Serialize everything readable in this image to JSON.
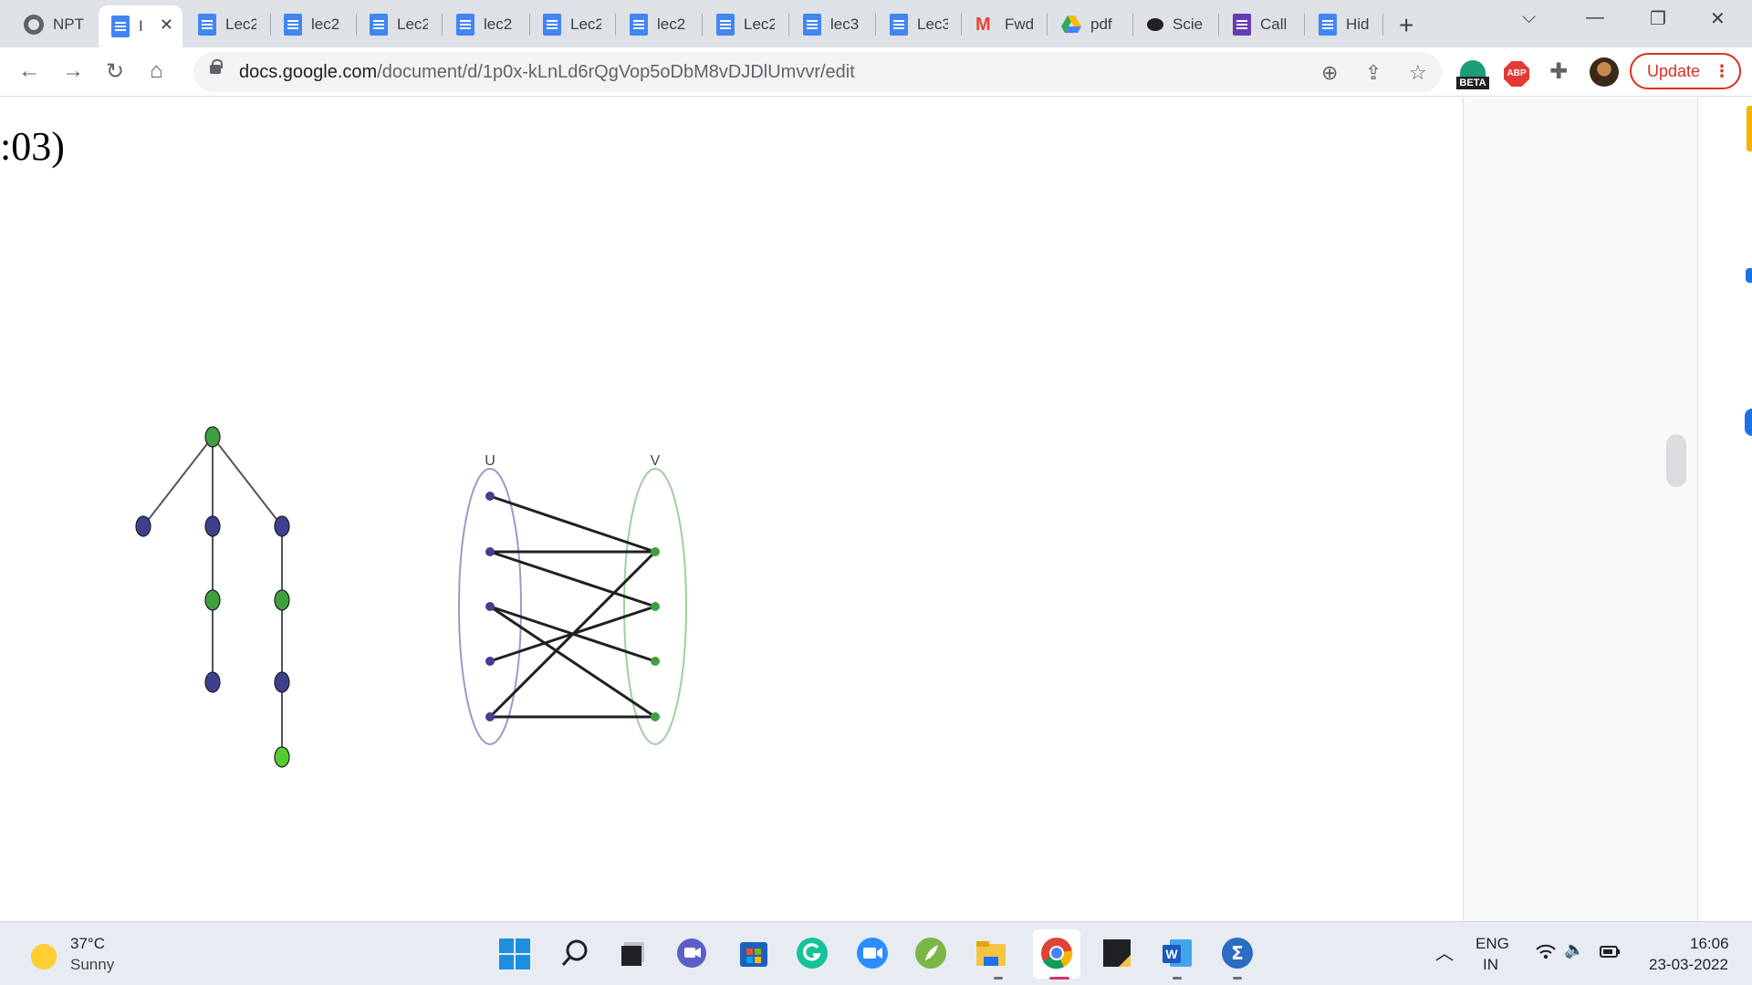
{
  "tabs": [
    {
      "label": "NPT",
      "icon": "globe-icon",
      "active": false
    },
    {
      "label": "I",
      "icon": "docs-icon",
      "active": true
    },
    {
      "label": "Lec2",
      "icon": "docs-icon",
      "active": false
    },
    {
      "label": "lec2",
      "icon": "docs-icon",
      "active": false
    },
    {
      "label": "Lec2",
      "icon": "docs-icon",
      "active": false
    },
    {
      "label": "lec2",
      "icon": "docs-icon",
      "active": false
    },
    {
      "label": "Lec2",
      "icon": "docs-icon",
      "active": false
    },
    {
      "label": "lec2",
      "icon": "docs-icon",
      "active": false
    },
    {
      "label": "Lec2",
      "icon": "docs-icon",
      "active": false
    },
    {
      "label": "lec3",
      "icon": "docs-icon",
      "active": false
    },
    {
      "label": "Lec3",
      "icon": "docs-icon",
      "active": false
    },
    {
      "label": "Fwd",
      "icon": "gmail-icon",
      "active": false
    },
    {
      "label": "pdf",
      "icon": "drive-icon",
      "active": false
    },
    {
      "label": "Scie",
      "icon": "chat-icon",
      "active": false
    },
    {
      "label": "Call",
      "icon": "forms-icon",
      "active": false
    },
    {
      "label": "Hid",
      "icon": "docs-icon",
      "active": false
    }
  ],
  "address": {
    "host": "docs.google.com",
    "path": "/document/d/1p0x-kLnLd6rQgVop5oDbM8vDJDlUmvvr/edit"
  },
  "toolbar": {
    "beta_label": "BETA",
    "abp_label": "ABP",
    "update_label": "Update"
  },
  "document": {
    "heading": ":03)",
    "bipartite_left_label": "U",
    "bipartite_right_label": "V"
  },
  "colors": {
    "node_purple": "#3f3f8f",
    "node_green": "#3f9f3f",
    "node_light_green": "#55cc33",
    "left_set_outline": "#9a9ac8",
    "right_set_outline": "#9fcf9f",
    "edge": "#202020",
    "tree_edge": "#555555",
    "update_red": "#d93025"
  },
  "taskbar": {
    "temperature": "37°C",
    "weather": "Sunny",
    "language": "ENG",
    "region": "IN",
    "time": "16:06",
    "date": "23-03-2022"
  }
}
